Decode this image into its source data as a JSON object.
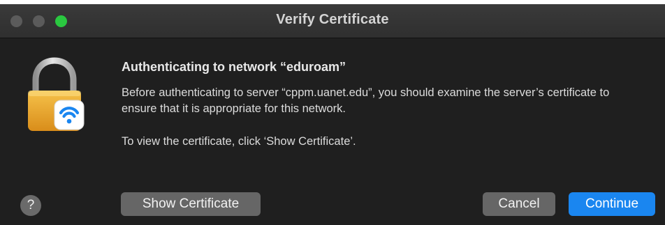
{
  "window": {
    "title": "Verify Certificate"
  },
  "dialog": {
    "heading": "Authenticating to network “eduroam”",
    "message": "Before authenticating to server “cppm.uanet.edu”, you should examine the server’s certificate to ensure that it is appropriate for this network.",
    "instruction": "To view the certificate, click ‘Show Certificate’.",
    "icon": "lock-wifi-icon"
  },
  "buttons": {
    "help_label": "?",
    "show_certificate_label": "Show Certificate",
    "cancel_label": "Cancel",
    "continue_label": "Continue"
  },
  "colors": {
    "window_bg": "#1f1f1f",
    "accent": "#1a86f0",
    "zoom_button": "#2ac840"
  }
}
